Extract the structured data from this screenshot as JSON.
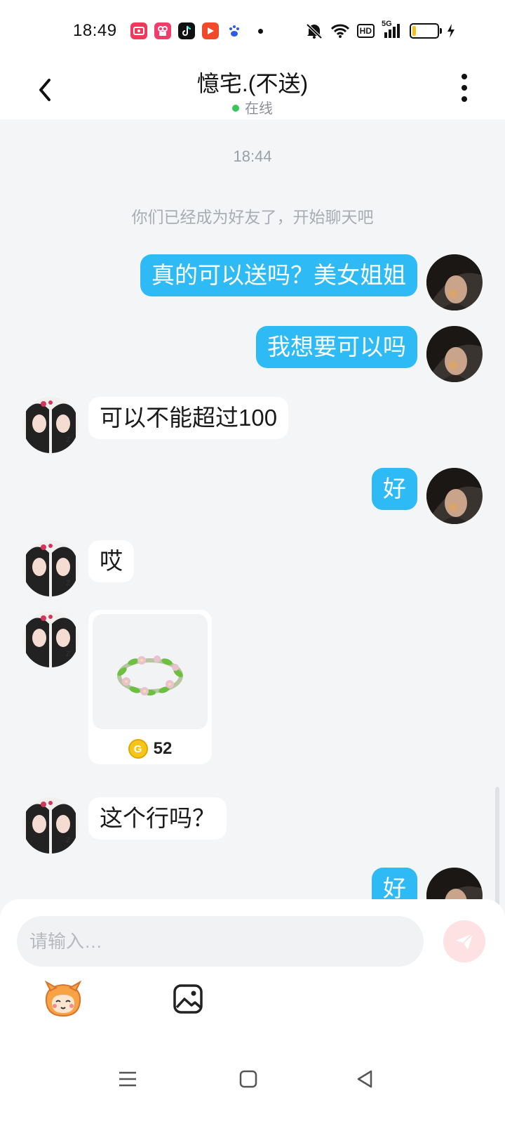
{
  "status_bar": {
    "time": "18:49",
    "network": "5G",
    "hd": "HD",
    "icons": [
      "screen-record-icon",
      "kuaishou-app-icon",
      "tiktok-app-icon",
      "video-app-icon",
      "baidu-app-icon",
      "notification-dot",
      "mute-icon",
      "wifi-icon",
      "hd-icon",
      "signal-icon",
      "battery-icon",
      "charging-icon"
    ]
  },
  "header": {
    "title": "憶宅.(不送)",
    "status": "在线",
    "status_color": "#36c75a"
  },
  "chat": {
    "timestamp": "18:44",
    "system_message": "你们已经成为好友了，开始聊天吧",
    "messages": [
      {
        "side": "right",
        "type": "text",
        "text": "真的可以送吗？美女姐姐"
      },
      {
        "side": "right",
        "type": "text",
        "text": "我想要可以吗"
      },
      {
        "side": "left",
        "type": "text",
        "text": "可以不能超过100"
      },
      {
        "side": "right",
        "type": "text",
        "text": "好"
      },
      {
        "side": "left",
        "type": "text",
        "text": "哎"
      },
      {
        "side": "left",
        "type": "gift",
        "gift_icon": "flower-wreath",
        "price": "52",
        "currency_icon": "coin-icon"
      },
      {
        "side": "left",
        "type": "text",
        "text": "这个行吗？"
      },
      {
        "side": "right",
        "type": "text",
        "text": "好"
      }
    ]
  },
  "input": {
    "placeholder": "请输入…",
    "value": ""
  },
  "colors": {
    "outgoing_bubble": "#2ebbf5",
    "incoming_bubble": "#ffffff",
    "background": "#f4f5f7",
    "send_button": "#fde1e3"
  },
  "nav": {
    "icons": [
      "menu-icon",
      "home-icon",
      "back-icon"
    ]
  }
}
